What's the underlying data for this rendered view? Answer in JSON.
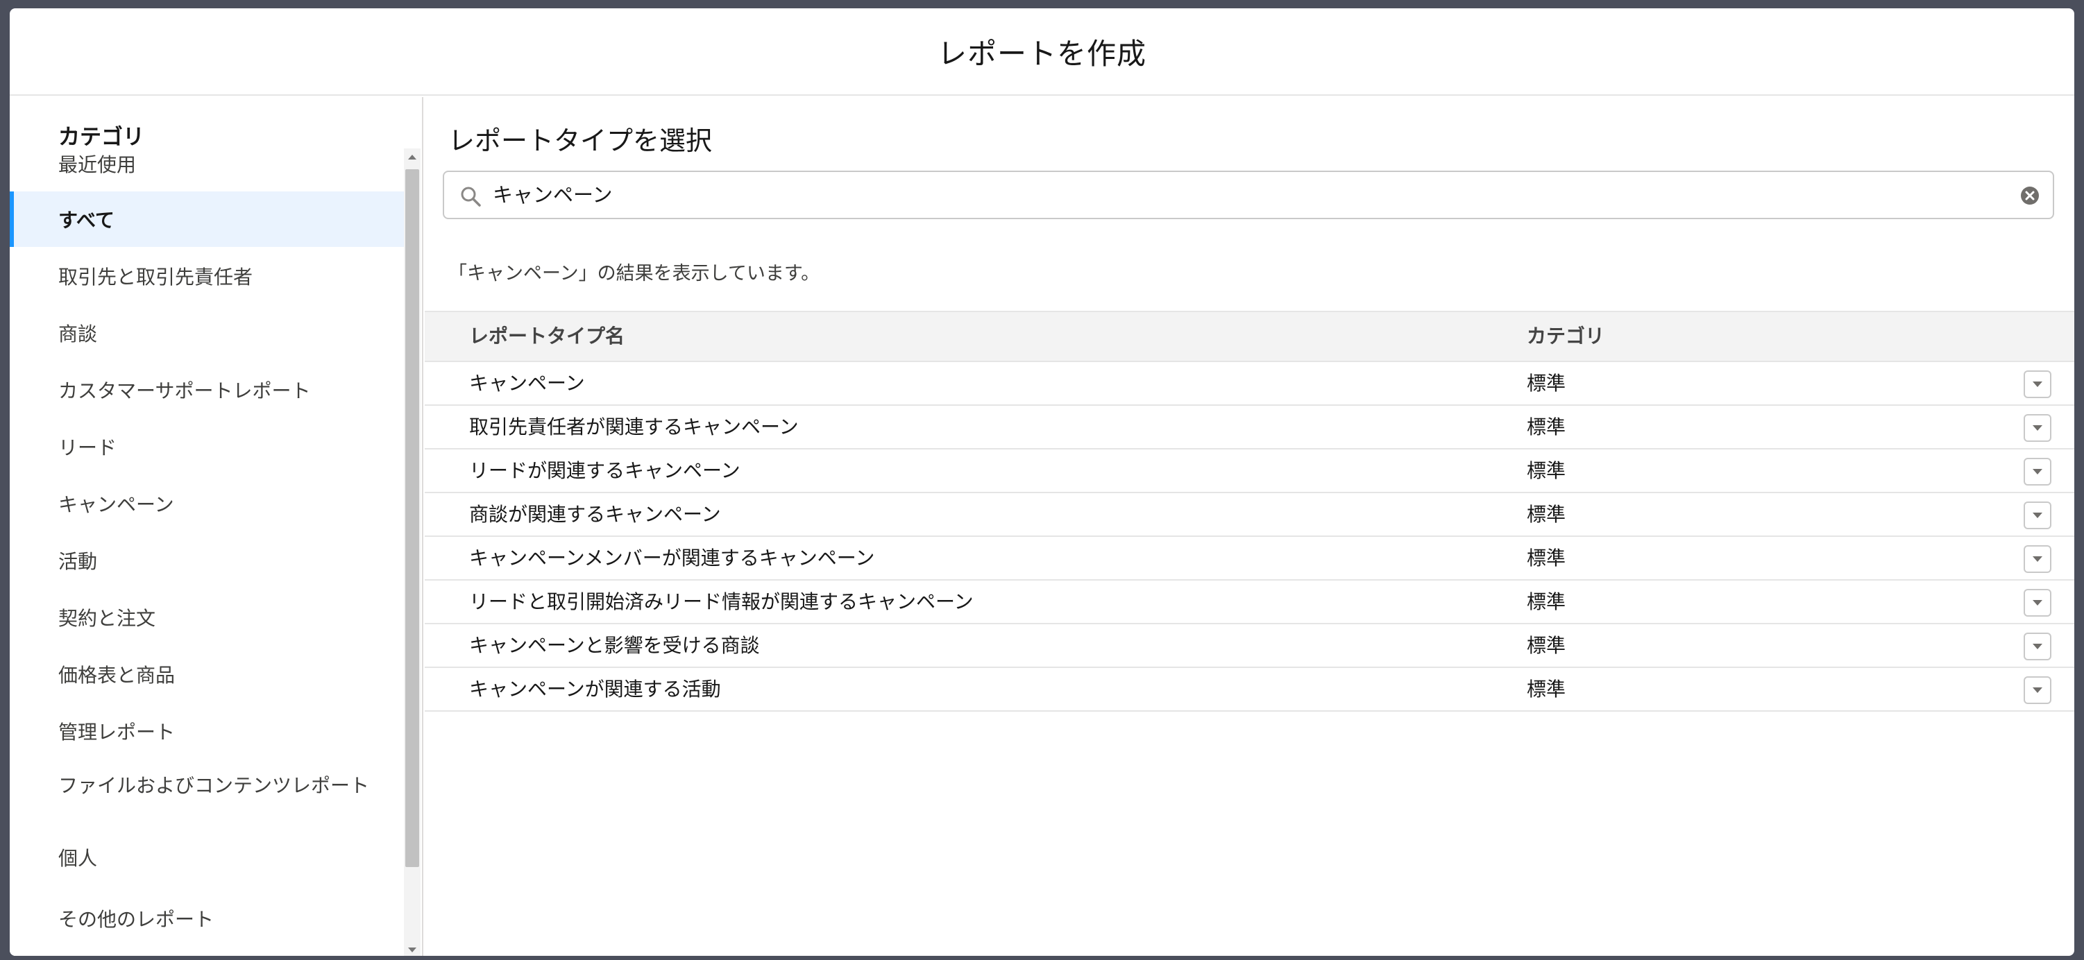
{
  "modal": {
    "title": "レポートを作成"
  },
  "sidebar": {
    "heading": "カテゴリ",
    "items": [
      {
        "label": "最近使用"
      },
      {
        "label": "すべて",
        "active": true
      },
      {
        "label": "取引先と取引先責任者"
      },
      {
        "label": "商談"
      },
      {
        "label": "カスタマーサポートレポート"
      },
      {
        "label": "リード"
      },
      {
        "label": "キャンペーン"
      },
      {
        "label": "活動"
      },
      {
        "label": "契約と注文"
      },
      {
        "label": "価格表と商品"
      },
      {
        "label": "管理レポート"
      },
      {
        "label": "ファイルおよびコンテンツレポート"
      },
      {
        "label": "個人"
      },
      {
        "label": "その他のレポート"
      }
    ]
  },
  "main": {
    "title": "レポートタイプを選択",
    "search": {
      "value": "キャンペーン",
      "icon": "search-icon",
      "clear_icon": "clear-icon"
    },
    "result_message": "「キャンペーン」の結果を表示しています。",
    "table": {
      "columns": [
        "レポートタイプ名",
        "カテゴリ"
      ],
      "rows": [
        {
          "name": "キャンペーン",
          "category": "標準"
        },
        {
          "name": "取引先責任者が関連するキャンペーン",
          "category": "標準"
        },
        {
          "name": "リードが関連するキャンペーン",
          "category": "標準"
        },
        {
          "name": "商談が関連するキャンペーン",
          "category": "標準"
        },
        {
          "name": "キャンペーンメンバーが関連するキャンペーン",
          "category": "標準"
        },
        {
          "name": "リードと取引開始済みリード情報が関連するキャンペーン",
          "category": "標準"
        },
        {
          "name": "キャンペーンと影響を受ける商談",
          "category": "標準"
        },
        {
          "name": "キャンペーンが関連する活動",
          "category": "標準"
        }
      ]
    }
  },
  "colors": {
    "accent": "#1b96ff",
    "active_bg": "#eaf3fe",
    "header_bg": "#f3f3f3"
  }
}
